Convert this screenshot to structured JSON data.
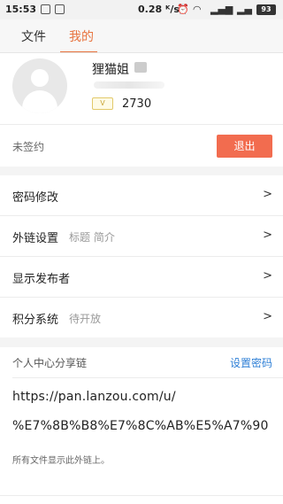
{
  "status_bar": {
    "time": "15:53",
    "speed": "0.28 ᴷ/s",
    "battery": "93"
  },
  "tabs": [
    {
      "label": "文件"
    },
    {
      "label": "我的"
    }
  ],
  "profile": {
    "username": "狸猫姐",
    "level_badge": "V",
    "points": "2730"
  },
  "sign": {
    "status": "未签约",
    "logout_label": "退出"
  },
  "menu": [
    {
      "label": "密码修改",
      "sub": ""
    },
    {
      "label": "外链设置",
      "sub": "标题 简介"
    },
    {
      "label": "显示发布者",
      "sub": ""
    },
    {
      "label": "积分系统",
      "sub": "待开放"
    }
  ],
  "chevron": ">",
  "share": {
    "title": "个人中心分享链",
    "set_password": "设置密码",
    "link_line1": "https://pan.lanzou.com/u/",
    "link_line2": "%E7%8B%B8%E7%8C%AB%E5%A7%90",
    "note": "所有文件显示此外链上。"
  },
  "colors": {
    "accent": "#e8743f",
    "logout": "#f26c4f",
    "link": "#2e7fd6"
  }
}
